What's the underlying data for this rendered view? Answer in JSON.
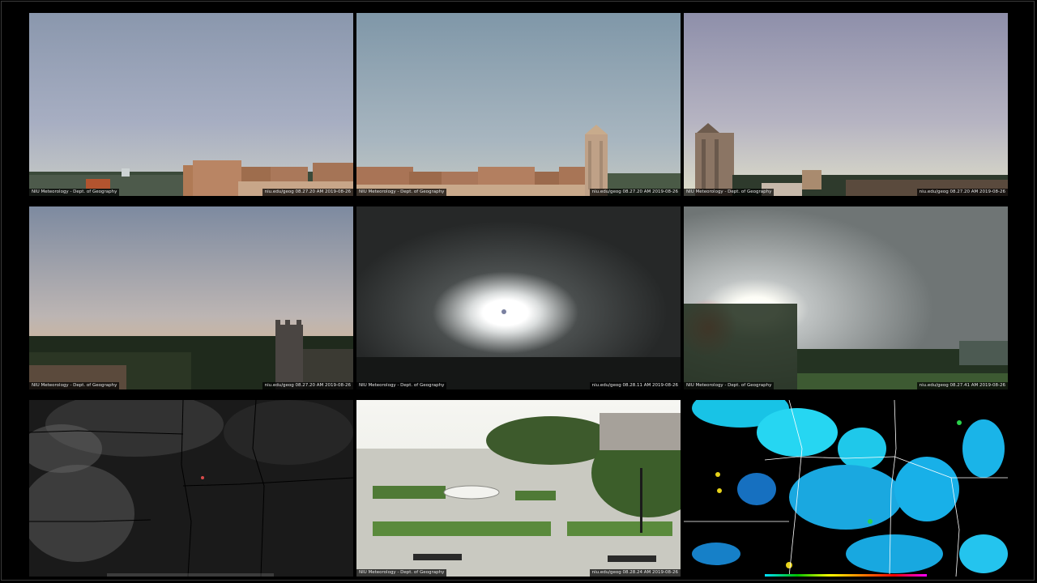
{
  "dashboard": {
    "tiles": [
      {
        "id": "cam-1",
        "caption_left": "NIU Meteorology - Dept. of Geography",
        "caption_right": "niu.edu/geog  08.27.20 AM 2019-08-26"
      },
      {
        "id": "cam-2",
        "caption_left": "NIU Meteorology - Dept. of Geography",
        "caption_right": "niu.edu/geog  08.27.20 AM 2019-08-26"
      },
      {
        "id": "cam-3",
        "caption_left": "NIU Meteorology - Dept. of Geography",
        "caption_right": "niu.edu/geog  08.27.20 AM 2019-08-26"
      },
      {
        "id": "cam-4",
        "caption_left": "NIU Meteorology - Dept. of Geography",
        "caption_right": "niu.edu/geog  08.27.20 AM 2019-08-26"
      },
      {
        "id": "cam-5",
        "caption_left": "NIU Meteorology - Dept. of Geography",
        "caption_right": "niu.edu/geog  08.28.11 AM 2019-08-26"
      },
      {
        "id": "cam-6",
        "caption_left": "NIU Meteorology - Dept. of Geography",
        "caption_right": "niu.edu/geog  08.27.41 AM 2019-08-26"
      },
      {
        "id": "satellite",
        "caption_center": ""
      },
      {
        "id": "cam-8",
        "caption_left": "NIU Meteorology - Dept. of Geography",
        "caption_right": "niu.edu/geog  08.28.24 AM 2019-08-26"
      },
      {
        "id": "radar"
      }
    ]
  }
}
